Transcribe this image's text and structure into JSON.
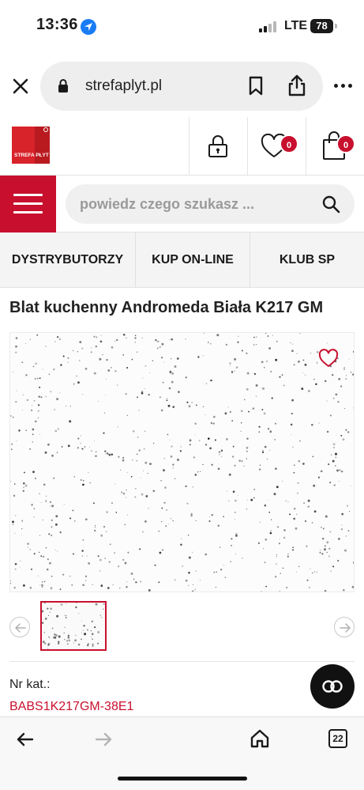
{
  "status_bar": {
    "time": "13:36",
    "network": "LTE",
    "battery": "78"
  },
  "browser": {
    "url": "strefaplyt.pl",
    "open_tabs": "22"
  },
  "site": {
    "logo_text": "STREFA PŁYT",
    "wishlist_count": "0",
    "cart_count": "0",
    "search_placeholder": "powiedz czego szukasz ...",
    "nav": [
      "DYSTRYBUTORZY",
      "KUP ON-LINE",
      "KLUB SP"
    ]
  },
  "product": {
    "title": "Blat kuchenny Andromeda Biała K217 GM",
    "catalog_label": "Nr kat.:",
    "catalog_number": "BABS1K217GM-38E1"
  },
  "colors": {
    "brand_red": "#c8102e",
    "ios_blue": "#1a7cf5"
  },
  "icons": [
    "close-icon",
    "lock-icon",
    "bookmark-icon",
    "share-icon",
    "more-icon",
    "account-lock-icon",
    "heart-icon",
    "cart-icon",
    "menu-icon",
    "search-icon",
    "prev-arrow-icon",
    "next-arrow-icon",
    "chat-icon",
    "back-icon",
    "forward-icon",
    "home-icon",
    "tabs-icon"
  ]
}
